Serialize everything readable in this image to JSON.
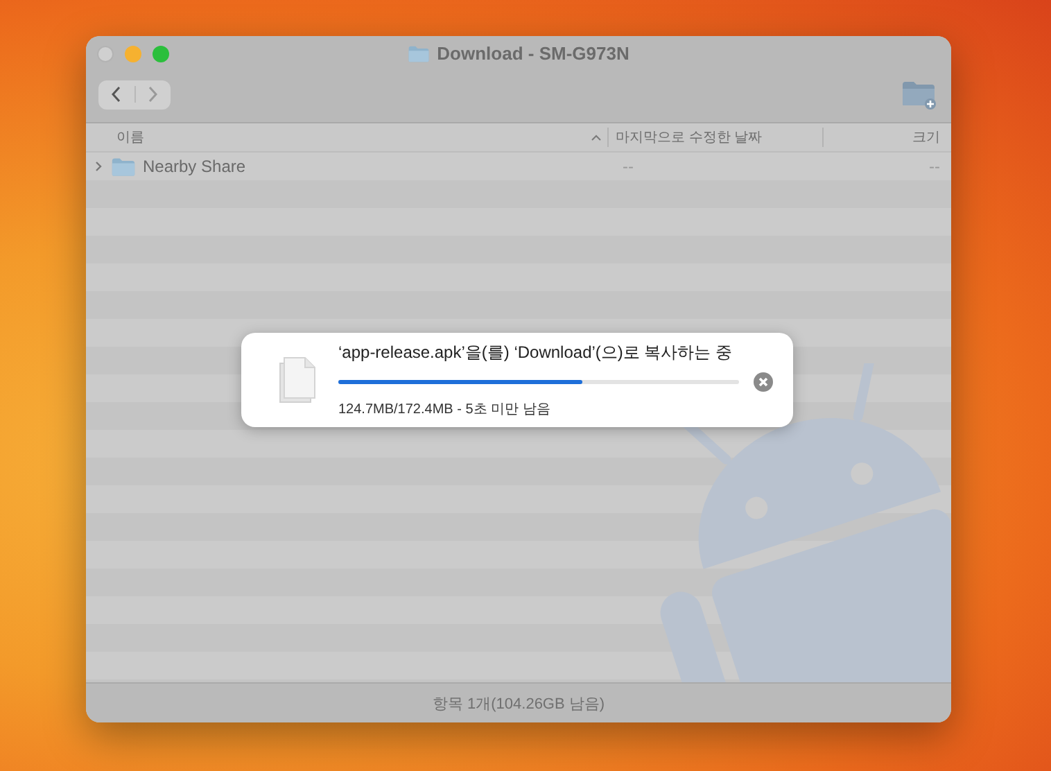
{
  "window": {
    "title": "Download - SM-G973N"
  },
  "columns": [
    {
      "label": "이름",
      "sorted": true
    },
    {
      "label": "마지막으로 수정한 날짜",
      "sorted": false
    },
    {
      "label": "크기",
      "sorted": false
    }
  ],
  "rows": [
    {
      "name": "Nearby Share",
      "modified": "--",
      "size": "--",
      "expanded": false
    }
  ],
  "status_bar": "항목 1개(104.26GB 남음)",
  "copy_dialog": {
    "message": "‘app-release.apk’을(를) ‘Download’(으)로 복사하는 중",
    "level": 0.61,
    "progress_text": "124.7MB/172.4MB - 5초 미만 남음"
  }
}
